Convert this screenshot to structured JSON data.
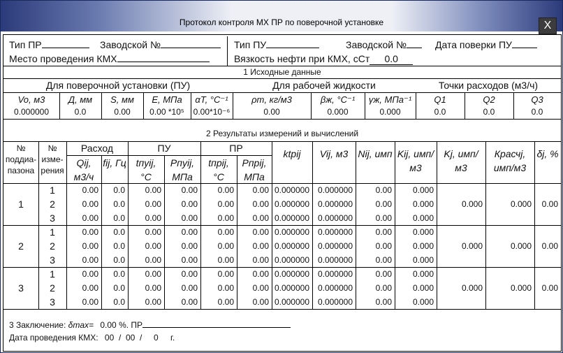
{
  "window": {
    "title": "Протокол контроля МХ ПР по поверочной установке",
    "close_label": "X"
  },
  "header": {
    "type_pr": "Тип ПР",
    "serial_label": "Заводской №",
    "place_label": "Место проведения КМХ",
    "type_pu": "Тип ПУ",
    "serial_pu_label": "Заводской №",
    "date_pu_label": "Дата поверки ПУ",
    "viscosity_label": "Вязкость нефти при КМХ, сСт",
    "viscosity_value": "0.0"
  },
  "section1": {
    "title": "1 Исходные данные",
    "group_pu": "Для поверочной установки (ПУ)",
    "group_fluid": "Для рабочей жидкости",
    "group_flow": "Точки расходов (м3/ч)",
    "cols": [
      "Vo, м3",
      "Д, мм",
      "S, мм",
      "E, МПа",
      "αT, °C⁻¹",
      "ρm, кг/м3",
      "βж, °C⁻¹",
      "γж, МПа⁻¹",
      "Q1",
      "Q2",
      "Q3"
    ],
    "values": [
      "0.000000",
      "0.0",
      "0.00",
      "0.00 *10⁵",
      "0.00*10⁻⁶",
      "0.00",
      "0.000",
      "0.000",
      "0.0",
      "0.0",
      "0.0"
    ]
  },
  "section2": {
    "title": "2 Результаты измерений и вычислений",
    "h_range": "№ поддиа-пазона",
    "h_meas": "№ изме-рения",
    "h_flow": "Расход",
    "h_pu": "ПУ",
    "h_pr": "ПР",
    "h_qij": "Qij, м3/ч",
    "h_fij": "fij, Гц",
    "h_tpuij": "tпуij, °C",
    "h_ppuij": "Рпуij, МПа",
    "h_tprij": "tпрij, °C",
    "h_pprij": "Рпрij, МПа",
    "h_ktpij": "ktpij",
    "h_vij": "Vij, м3",
    "h_nij": "Nij, имп",
    "h_kij": "Kij, имп/м3",
    "h_kj": "Kj, имп/м3",
    "h_krasc": "Красчj, имп/м3",
    "h_delta": "δj, %",
    "ranges": [
      {
        "num": "1",
        "kj": "0.000",
        "krasc": "0.000",
        "delta": "0.00",
        "rows": [
          {
            "m": "1",
            "q": "0.00",
            "f": "0.0",
            "t1": "0.00",
            "p1": "0.00",
            "t2": "0.00",
            "p2": "0.00",
            "k": "0.000000",
            "v": "0.000000",
            "n": "0.00",
            "ki": "0.000"
          },
          {
            "m": "2",
            "q": "0.00",
            "f": "0.0",
            "t1": "0.00",
            "p1": "0.00",
            "t2": "0.00",
            "p2": "0.00",
            "k": "0.000000",
            "v": "0.000000",
            "n": "0.00",
            "ki": "0.000"
          },
          {
            "m": "3",
            "q": "0.00",
            "f": "0.0",
            "t1": "0.00",
            "p1": "0.00",
            "t2": "0.00",
            "p2": "0.00",
            "k": "0.000000",
            "v": "0.000000",
            "n": "0.00",
            "ki": "0.000"
          }
        ]
      },
      {
        "num": "2",
        "kj": "0.000",
        "krasc": "0.000",
        "delta": "0.00",
        "rows": [
          {
            "m": "1",
            "q": "0.00",
            "f": "0.0",
            "t1": "0.00",
            "p1": "0.00",
            "t2": "0.00",
            "p2": "0.00",
            "k": "0.000000",
            "v": "0.000000",
            "n": "0.00",
            "ki": "0.000"
          },
          {
            "m": "2",
            "q": "0.00",
            "f": "0.0",
            "t1": "0.00",
            "p1": "0.00",
            "t2": "0.00",
            "p2": "0.00",
            "k": "0.000000",
            "v": "0.000000",
            "n": "0.00",
            "ki": "0.000"
          },
          {
            "m": "3",
            "q": "0.00",
            "f": "0.0",
            "t1": "0.00",
            "p1": "0.00",
            "t2": "0.00",
            "p2": "0.00",
            "k": "0.000000",
            "v": "0.000000",
            "n": "0.00",
            "ki": "0.000"
          }
        ]
      },
      {
        "num": "3",
        "kj": "0.000",
        "krasc": "0.000",
        "delta": "0.00",
        "rows": [
          {
            "m": "1",
            "q": "0.00",
            "f": "0.0",
            "t1": "0.00",
            "p1": "0.00",
            "t2": "0.00",
            "p2": "0.00",
            "k": "0.000000",
            "v": "0.000000",
            "n": "0.00",
            "ki": "0.000"
          },
          {
            "m": "2",
            "q": "0.00",
            "f": "0.0",
            "t1": "0.00",
            "p1": "0.00",
            "t2": "0.00",
            "p2": "0.00",
            "k": "0.000000",
            "v": "0.000000",
            "n": "0.00",
            "ki": "0.000"
          },
          {
            "m": "3",
            "q": "0.00",
            "f": "0.0",
            "t1": "0.00",
            "p1": "0.00",
            "t2": "0.00",
            "p2": "0.00",
            "k": "0.000000",
            "v": "0.000000",
            "n": "0.00",
            "ki": "0.000"
          }
        ]
      }
    ]
  },
  "footer": {
    "conclusion_label": "3 Заключение:",
    "delta_max_label": "δmax=",
    "delta_max_value": "0.00",
    "pct_pr": "%. ПР",
    "date_label": "Дата проведения КМХ:",
    "date_value": "00  /  00  /     0",
    "year_suffix": "г."
  }
}
